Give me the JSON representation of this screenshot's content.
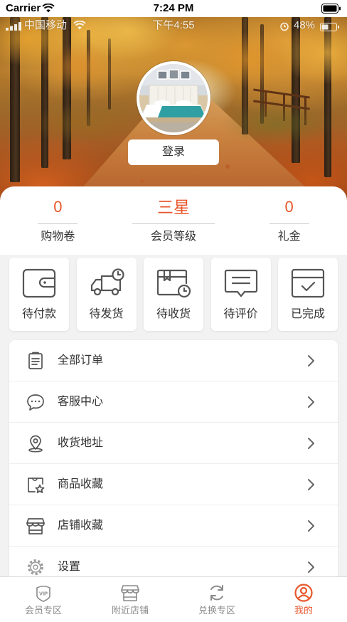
{
  "colors": {
    "accent": "#e8572b",
    "text": "#333333",
    "icon": "#555555",
    "page_bg": "#f2f2f2"
  },
  "status_bar": {
    "carrier": "Carrier",
    "time": "7:24 PM",
    "wifi_icon": "wifi-icon",
    "battery_icon": "battery-icon"
  },
  "header": {
    "overlay_status": {
      "carrier": "中国移动",
      "time": "下午4:55",
      "battery": "48%"
    },
    "login_label": "登录"
  },
  "stats": [
    {
      "value": "0",
      "label": "购物卷"
    },
    {
      "value": "三星",
      "label": "会员等级"
    },
    {
      "value": "0",
      "label": "礼金"
    }
  ],
  "orders": [
    {
      "label": "待付款",
      "icon": "wallet-icon"
    },
    {
      "label": "待发货",
      "icon": "truck-clock-icon"
    },
    {
      "label": "待收货",
      "icon": "package-clock-icon"
    },
    {
      "label": "待评价",
      "icon": "comment-icon"
    },
    {
      "label": "已完成",
      "icon": "calendar-check-icon"
    }
  ],
  "menu": [
    {
      "label": "全部订单",
      "icon": "clipboard-icon"
    },
    {
      "label": "客服中心",
      "icon": "chat-bubble-icon"
    },
    {
      "label": "收货地址",
      "icon": "location-pin-icon"
    },
    {
      "label": "商品收藏",
      "icon": "favorite-product-icon"
    },
    {
      "label": "店铺收藏",
      "icon": "store-icon"
    },
    {
      "label": "设置",
      "icon": "gear-icon"
    }
  ],
  "tabbar": [
    {
      "label": "会员专区",
      "icon": "vip-icon",
      "icon_text": "VIP",
      "active": false
    },
    {
      "label": "附近店铺",
      "icon": "shop-icon",
      "active": false
    },
    {
      "label": "兑换专区",
      "icon": "refresh-icon",
      "active": false
    },
    {
      "label": "我的",
      "icon": "user-icon",
      "active": true
    }
  ]
}
